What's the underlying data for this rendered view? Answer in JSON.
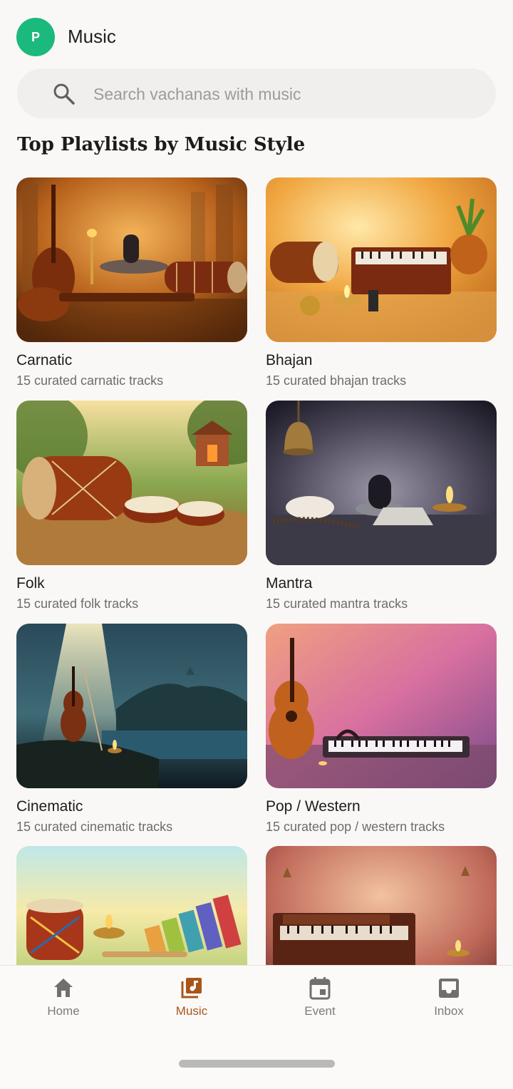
{
  "header": {
    "avatar_initial": "P",
    "title": "Music"
  },
  "search": {
    "placeholder": "Search vachanas with music",
    "icon": "search-icon"
  },
  "section_title": "Top Playlists by Music Style",
  "playlists": [
    {
      "title": "Carnatic",
      "subtitle": "15 curated carnatic tracks",
      "image": "veena-mridangam-shivalinga"
    },
    {
      "title": "Bhajan",
      "subtitle": "15 curated bhajan tracks",
      "image": "dholak-harmonium-diya"
    },
    {
      "title": "Folk",
      "subtitle": "15 curated folk tracks",
      "image": "drums-village-shrine"
    },
    {
      "title": "Mantra",
      "subtitle": "15 curated mantra tracks",
      "image": "bell-conch-shivalinga"
    },
    {
      "title": "Cinematic",
      "subtitle": "15 curated cinematic tracks",
      "image": "violin-river-temple"
    },
    {
      "title": "Pop / Western",
      "subtitle": "15 curated pop / western tracks",
      "image": "guitar-keyboard-headphones"
    },
    {
      "title": "",
      "subtitle": "",
      "image": "drum-xylophone-diya"
    },
    {
      "title": "",
      "subtitle": "",
      "image": "harmonium-bells"
    }
  ],
  "bottom_nav": [
    {
      "label": "Home",
      "icon": "home-icon",
      "active": false
    },
    {
      "label": "Music",
      "icon": "music-library-icon",
      "active": true
    },
    {
      "label": "Event",
      "icon": "calendar-icon",
      "active": false
    },
    {
      "label": "Inbox",
      "icon": "inbox-icon",
      "active": false
    }
  ],
  "colors": {
    "accent": "#a8551a",
    "avatar": "#1bb97b",
    "background": "#faf8f6"
  }
}
